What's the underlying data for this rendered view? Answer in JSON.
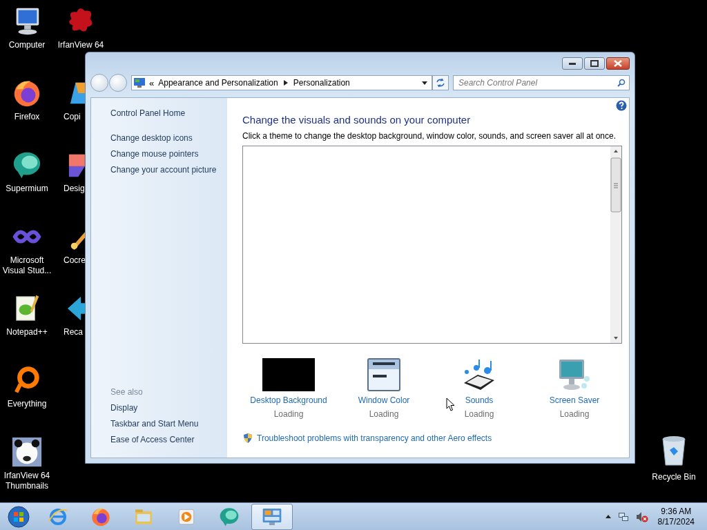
{
  "desktop_icons": [
    {
      "label": "Computer",
      "kind": "computer",
      "cut": false
    },
    {
      "label": "Firefox",
      "kind": "firefox",
      "cut": false
    },
    {
      "label": "Supermium",
      "kind": "supermium",
      "cut": false
    },
    {
      "label": "Microsoft Visual Stud...",
      "kind": "vs",
      "cut": false
    },
    {
      "label": "Notepad++",
      "kind": "notepad",
      "cut": false
    },
    {
      "label": "Everything",
      "kind": "everything",
      "cut": false
    },
    {
      "label": "IrfanView 64 Thumbnails",
      "kind": "panda",
      "cut": false
    },
    {
      "label": "IrfanView 64",
      "kind": "irfanview",
      "cut": false
    },
    {
      "label": "Copi",
      "kind": "copilot",
      "cut": true
    },
    {
      "label": "Desig",
      "kind": "designer",
      "cut": true
    },
    {
      "label": "Cocre",
      "kind": "cocreator",
      "cut": true
    },
    {
      "label": "Reca",
      "kind": "recall",
      "cut": true
    }
  ],
  "window": {
    "address": {
      "chevron": "«",
      "crumbs": [
        "Appearance and Personalization",
        "Personalization"
      ],
      "search_placeholder": "Search Control Panel"
    },
    "sidebar": {
      "links": [
        "Control Panel Home",
        "Change desktop icons",
        "Change mouse pointers",
        "Change your account picture"
      ],
      "see_also_title": "See also",
      "see_also": [
        "Display",
        "Taskbar and Start Menu",
        "Ease of Access Center"
      ]
    },
    "heading": "Change the visuals and sounds on your computer",
    "description": "Click a theme to change the desktop background, window color, sounds, and screen saver all at once.",
    "settings": [
      {
        "label": "Desktop Background",
        "status": "Loading",
        "kind": "background"
      },
      {
        "label": "Window Color",
        "status": "Loading",
        "kind": "color"
      },
      {
        "label": "Sounds",
        "status": "Loading",
        "kind": "sounds"
      },
      {
        "label": "Screen Saver",
        "status": "Loading",
        "kind": "saver"
      }
    ],
    "troubleshoot_link": "Troubleshoot problems with transparency and other Aero effects"
  },
  "recycle_bin": {
    "label": "Recycle Bin"
  },
  "taskbar": {
    "apps": [
      {
        "kind": "ie",
        "selected": false
      },
      {
        "kind": "firefox",
        "selected": false
      },
      {
        "kind": "explorer",
        "selected": false
      },
      {
        "kind": "media",
        "selected": false
      },
      {
        "kind": "supermium",
        "selected": false
      },
      {
        "kind": "controlpanel",
        "selected": true
      }
    ],
    "clock": {
      "time": "9:36 AM",
      "date": "8/17/2024"
    }
  }
}
